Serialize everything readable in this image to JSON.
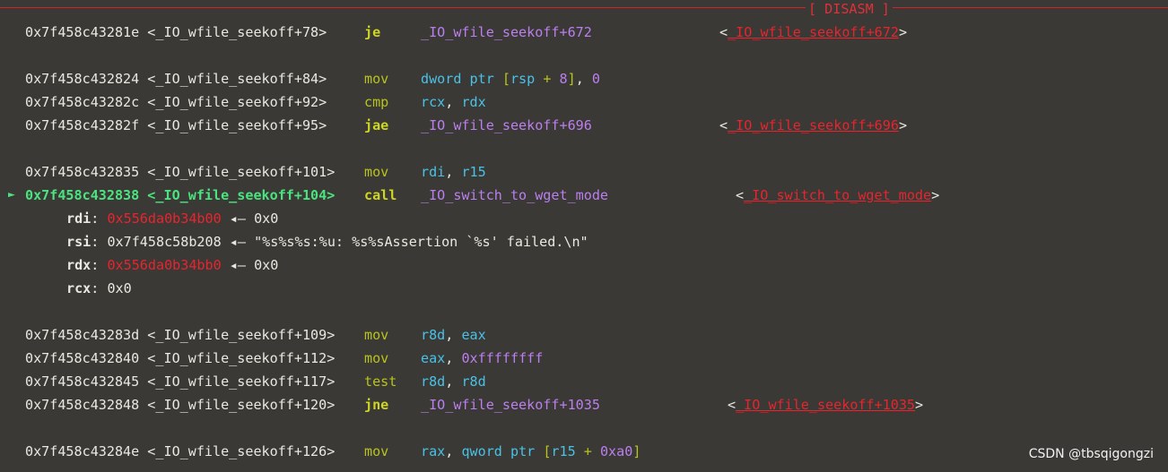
{
  "header": {
    "label": "[ DISASM ]"
  },
  "lines": {
    "l1": {
      "addr": "0x7f458c43281e <_IO_wfile_seekoff+78>",
      "mnem": "je",
      "ops": "_IO_wfile_seekoff+672",
      "target": "_IO_wfile_seekoff+672"
    },
    "l2": {
      "addr": "0x7f458c432824 <_IO_wfile_seekoff+84>",
      "mnem": "mov",
      "ops": {
        "a": "dword ptr ",
        "b": "[",
        "c": "rsp",
        "d": " + ",
        "e": "8",
        "f": "]",
        "g": ", ",
        "h": "0"
      }
    },
    "l3": {
      "addr": "0x7f458c43282c <_IO_wfile_seekoff+92>",
      "mnem": "cmp",
      "ops": {
        "a": "rcx",
        "b": ", ",
        "c": "rdx"
      }
    },
    "l4": {
      "addr": "0x7f458c43282f <_IO_wfile_seekoff+95>",
      "mnem": "jae",
      "ops": "_IO_wfile_seekoff+696",
      "target": "_IO_wfile_seekoff+696"
    },
    "l5": {
      "addr": "0x7f458c432835 <_IO_wfile_seekoff+101>",
      "mnem": "mov",
      "ops": {
        "a": "rdi",
        "b": ", ",
        "c": "r15"
      }
    },
    "l6": {
      "marker": "►",
      "addr": "0x7f458c432838 <_IO_wfile_seekoff+104>",
      "mnem": "call",
      "ops": "_IO_switch_to_wget_mode",
      "target": "_IO_switch_to_wget_mode"
    },
    "l7": {
      "addr": "0x7f458c43283d <_IO_wfile_seekoff+109>",
      "mnem": "mov",
      "ops": {
        "a": "r8d",
        "b": ", ",
        "c": "eax"
      }
    },
    "l8": {
      "addr": "0x7f458c432840 <_IO_wfile_seekoff+112>",
      "mnem": "mov",
      "ops": {
        "a": "eax",
        "b": ", ",
        "c": "0xffffffff"
      }
    },
    "l9": {
      "addr": "0x7f458c432845 <_IO_wfile_seekoff+117>",
      "mnem": "test",
      "ops": {
        "a": "r8d",
        "b": ", ",
        "c": "r8d"
      }
    },
    "l10": {
      "addr": "0x7f458c432848 <_IO_wfile_seekoff+120>",
      "mnem": "jne",
      "ops": "_IO_wfile_seekoff+1035",
      "target": "_IO_wfile_seekoff+1035"
    },
    "l11": {
      "addr": "0x7f458c43284e <_IO_wfile_seekoff+126>",
      "mnem": "mov",
      "ops": {
        "a": "rax",
        "b": ", ",
        "c": "qword ptr ",
        "d": "[",
        "e": "r15",
        "f": " + ",
        "g": "0xa0",
        "h": "]"
      }
    }
  },
  "args": {
    "rdi": {
      "name": "rdi",
      "value": "0x556da0b34b00",
      "arrow": "◂—",
      "deref": "0x0"
    },
    "rsi": {
      "name": "rsi",
      "value": "0x7f458c58b208",
      "arrow": "◂—",
      "deref": "\"%s%s%s:%u: %s%sAssertion `%s' failed.\\n\""
    },
    "rdx": {
      "name": "rdx",
      "value": "0x556da0b34bb0",
      "arrow": "◂—",
      "deref": "0x0"
    },
    "rcx": {
      "name": "rcx",
      "value": "0x0"
    }
  },
  "watermark": "CSDN @tbsqigongzi",
  "colors": {
    "background": "#3b3935",
    "address": "#e8e8e0",
    "current": "#4be37f",
    "mnemonic": "#b7c41c",
    "branch_mnemonic": "#cdd622",
    "symbol": "#bb7ff0",
    "register": "#48c2e8",
    "heap_pointer": "#e8242e",
    "rule": "#d2222a"
  }
}
